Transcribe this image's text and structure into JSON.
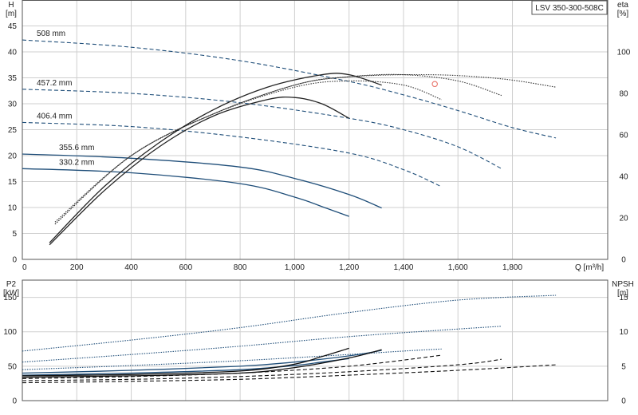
{
  "chart_data": [
    {
      "type": "line",
      "title": "LSV 350-300-508C",
      "xlabel": "Q [m³/h]",
      "ylabel": "H",
      "ylabel_unit": "[m]",
      "y2label": "eta",
      "y2label_unit": "[%]",
      "xlim": [
        0,
        2150
      ],
      "ylim": [
        0,
        50
      ],
      "y2lim": [
        0,
        125
      ],
      "x_ticks": [
        0,
        200,
        400,
        600,
        800,
        1000,
        1200,
        1400,
        1600,
        1800
      ],
      "x_tick_labels": [
        "0",
        "200",
        "400",
        "600",
        "800",
        "1,000",
        "1,200",
        "1,400",
        "1,600",
        "1,800"
      ],
      "y_ticks": [
        0,
        5,
        10,
        15,
        20,
        25,
        30,
        35,
        40,
        45
      ],
      "y2_ticks": [
        0,
        20,
        40,
        60,
        80,
        100
      ],
      "grid": true,
      "series": [
        {
          "name": "508 mm",
          "axis": "H",
          "style": "dashed",
          "color": "#1f4e79",
          "x": [
            0,
            400,
            800,
            1200,
            1400,
            1600,
            1800,
            1960
          ],
          "y": [
            42.3,
            40.9,
            38.3,
            34.3,
            31.7,
            28.7,
            25.4,
            23.4
          ]
        },
        {
          "name": "457.2 mm",
          "axis": "H",
          "style": "dashed",
          "color": "#1f4e79",
          "x": [
            0,
            400,
            800,
            1200,
            1400,
            1600,
            1760
          ],
          "y": [
            32.8,
            32.0,
            30.2,
            27.2,
            25.0,
            21.7,
            17.5
          ]
        },
        {
          "name": "406.4 mm",
          "axis": "H",
          "style": "dashed",
          "color": "#1f4e79",
          "x": [
            0,
            400,
            800,
            1200,
            1400,
            1540
          ],
          "y": [
            26.4,
            25.6,
            23.6,
            20.5,
            17.3,
            14.0
          ]
        },
        {
          "name": "355.6 mm",
          "axis": "H",
          "style": "solid",
          "color": "#1f4e79",
          "x": [
            0,
            400,
            800,
            1000,
            1200,
            1320
          ],
          "y": [
            20.3,
            19.5,
            17.8,
            15.6,
            12.5,
            9.9
          ]
        },
        {
          "name": "330.2 mm",
          "axis": "H",
          "style": "solid",
          "color": "#1f4e79",
          "x": [
            0,
            400,
            800,
            1000,
            1120,
            1200
          ],
          "y": [
            17.5,
            16.7,
            14.6,
            12.0,
            9.8,
            8.3
          ]
        },
        {
          "name": "",
          "axis": "eta",
          "style": "dotted",
          "color": "#333333",
          "x": [
            120,
            400,
            700,
            1000,
            1200,
            1500,
            1760,
            1960
          ],
          "y": [
            18,
            50,
            70,
            84,
            88,
            89,
            87,
            83
          ]
        },
        {
          "name": "",
          "axis": "eta",
          "style": "dotted",
          "color": "#333333",
          "x": [
            120,
            400,
            700,
            1000,
            1200,
            1400,
            1600,
            1760
          ],
          "y": [
            17,
            50,
            70,
            84,
            88,
            89,
            86,
            79
          ]
        },
        {
          "name": "",
          "axis": "eta",
          "style": "dotted",
          "color": "#333333",
          "x": [
            120,
            400,
            700,
            1000,
            1200,
            1400,
            1540
          ],
          "y": [
            17,
            50,
            70,
            83,
            86,
            84,
            77
          ]
        },
        {
          "name": "",
          "axis": "eta",
          "style": "solid",
          "color": "#222222",
          "x": [
            100,
            300,
            500,
            700,
            900,
            1100,
            1200,
            1320
          ],
          "y": [
            8,
            35,
            56,
            72,
            83,
            89,
            89,
            84
          ]
        },
        {
          "name": "",
          "axis": "eta",
          "style": "solid",
          "color": "#222222",
          "x": [
            100,
            300,
            500,
            700,
            900,
            1000,
            1100,
            1200
          ],
          "y": [
            7,
            33,
            54,
            69,
            77,
            78,
            75,
            68
          ]
        }
      ],
      "points": [
        {
          "x": 1515,
          "y": 33.8,
          "color": "#e8746a"
        }
      ]
    },
    {
      "type": "line",
      "title": "",
      "xlabel": "",
      "ylabel": "P2",
      "ylabel_unit": "[kW]",
      "y2label": "NPSH",
      "y2label_unit": "[m]",
      "xlim": [
        0,
        2150
      ],
      "ylim": [
        0,
        175
      ],
      "y2lim": [
        0,
        17.5
      ],
      "y_ticks": [
        0,
        50,
        100,
        150
      ],
      "y2_ticks": [
        0,
        5,
        10,
        15
      ],
      "grid": true,
      "series": [
        {
          "name": "",
          "axis": "P2",
          "style": "dotted",
          "color": "#1f4e79",
          "x": [
            0,
            400,
            800,
            1200,
            1600,
            1960
          ],
          "y": [
            72,
            88,
            106,
            128,
            146,
            153
          ]
        },
        {
          "name": "",
          "axis": "P2",
          "style": "dotted",
          "color": "#1f4e79",
          "x": [
            0,
            400,
            800,
            1200,
            1600,
            1760
          ],
          "y": [
            56,
            67,
            79,
            93,
            104,
            108
          ]
        },
        {
          "name": "",
          "axis": "P2",
          "style": "dotted",
          "color": "#1f4e79",
          "x": [
            0,
            400,
            800,
            1200,
            1400,
            1540
          ],
          "y": [
            45,
            51,
            58,
            67,
            72,
            75
          ]
        },
        {
          "name": "",
          "axis": "P2",
          "style": "solid",
          "color": "#1f4e79",
          "x": [
            0,
            400,
            800,
            1000,
            1200,
            1320
          ],
          "y": [
            40,
            44,
            50,
            56,
            65,
            73
          ]
        },
        {
          "name": "",
          "axis": "P2",
          "style": "solid",
          "color": "#1f4e79",
          "x": [
            0,
            400,
            800,
            1000,
            1100,
            1200
          ],
          "y": [
            37,
            40,
            45,
            51,
            56,
            61
          ]
        },
        {
          "name": "",
          "axis": "NPSH",
          "style": "dashed",
          "color": "#111111",
          "x": [
            0,
            400,
            800,
            1200,
            1600,
            1960
          ],
          "y": [
            2.6,
            2.8,
            3.1,
            3.7,
            4.4,
            5.2
          ]
        },
        {
          "name": "",
          "axis": "NPSH",
          "style": "dashed",
          "color": "#111111",
          "x": [
            0,
            400,
            800,
            1200,
            1600,
            1760
          ],
          "y": [
            2.9,
            3.1,
            3.5,
            4.2,
            5.2,
            6.0
          ]
        },
        {
          "name": "",
          "axis": "NPSH",
          "style": "dashed",
          "color": "#111111",
          "x": [
            0,
            400,
            800,
            1200,
            1540
          ],
          "y": [
            3.2,
            3.5,
            4.0,
            5.0,
            6.6
          ]
        },
        {
          "name": "",
          "axis": "NPSH",
          "style": "solid",
          "color": "#111111",
          "x": [
            0,
            400,
            800,
            1000,
            1200,
            1320
          ],
          "y": [
            3.4,
            3.6,
            4.0,
            4.8,
            6.2,
            7.4
          ]
        },
        {
          "name": "",
          "axis": "NPSH",
          "style": "solid",
          "color": "#111111",
          "x": [
            0,
            400,
            800,
            1000,
            1100,
            1200
          ],
          "y": [
            3.6,
            3.8,
            4.3,
            5.3,
            6.4,
            7.6
          ]
        }
      ]
    }
  ]
}
